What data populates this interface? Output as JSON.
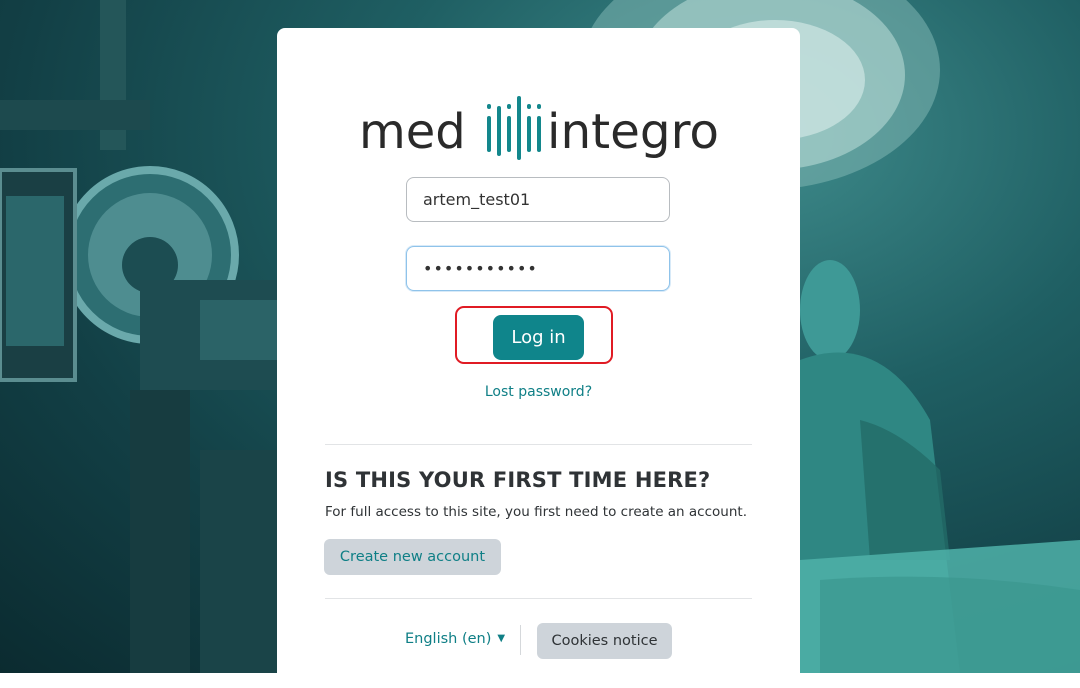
{
  "logo": {
    "left_text": "med",
    "right_text": "integro"
  },
  "login": {
    "username_value": "artem_test01",
    "password_value": "•••••••••••",
    "login_label": "Log in",
    "lost_password_label": "Lost password?"
  },
  "signup": {
    "heading": "IS THIS YOUR FIRST TIME HERE?",
    "text": "For full access to this site, you first need to create an account.",
    "create_label": "Create new account"
  },
  "footer": {
    "language_label": "English (en)",
    "language_chevron": "chevron-down-icon",
    "cookies_label": "Cookies notice"
  },
  "colors": {
    "brand_teal": "#0f858b",
    "highlight_red": "#e01b24"
  }
}
